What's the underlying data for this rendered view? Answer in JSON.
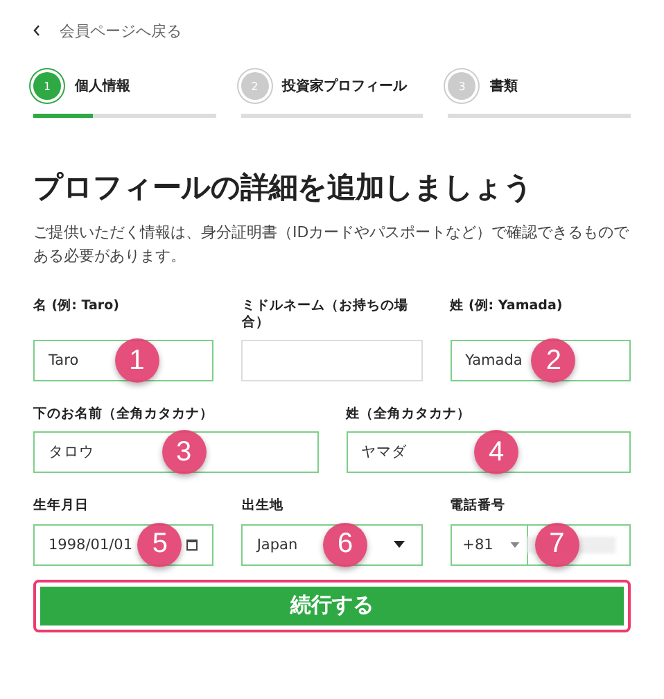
{
  "back_link": {
    "label": "会員ページへ戻る"
  },
  "steps": [
    {
      "number": "1",
      "label": "個人情報",
      "selected": true,
      "level": 0.33
    },
    {
      "number": "2",
      "label": "投資家プロフィール",
      "selected": false,
      "level": 0
    },
    {
      "number": "3",
      "label": "書類",
      "selected": false,
      "level": 0
    }
  ],
  "heading": "プロフィールの詳細を追加しましょう",
  "description": "ご提供いただく情報は、身分証明書（IDカードやパスポートなど）で確認できるものである必要があります。",
  "rows": [
    [
      {
        "kind": "text",
        "label": "名 (例: Taro)",
        "value": "Taro",
        "valid": true,
        "marker": "1"
      },
      {
        "kind": "text",
        "label": "ミドルネーム（お持ちの場合）",
        "valid": false
      },
      {
        "kind": "text",
        "label": "姓 (例: Yamada)",
        "value": "Yamada",
        "valid": true,
        "marker": "2"
      }
    ],
    [
      {
        "kind": "text",
        "label": "下のお名前（全角カタカナ）",
        "value": "タロウ",
        "valid": true,
        "marker": "3"
      },
      {
        "kind": "text",
        "label": "姓（全角カタカナ）",
        "value": "ヤマダ",
        "valid": true,
        "marker": "4"
      }
    ],
    [
      {
        "kind": "date",
        "label": "生年月日",
        "value": "1998/01/01",
        "valid": true,
        "marker": "5"
      },
      {
        "kind": "select",
        "label": "出生地",
        "value": "Japan",
        "valid": true,
        "marker": "6"
      },
      {
        "kind": "phone",
        "label": "電話番号",
        "value": "+81",
        "valid": true,
        "marker": "7"
      }
    ]
  ],
  "submit": {
    "label": "続行する",
    "highlighted": true
  }
}
